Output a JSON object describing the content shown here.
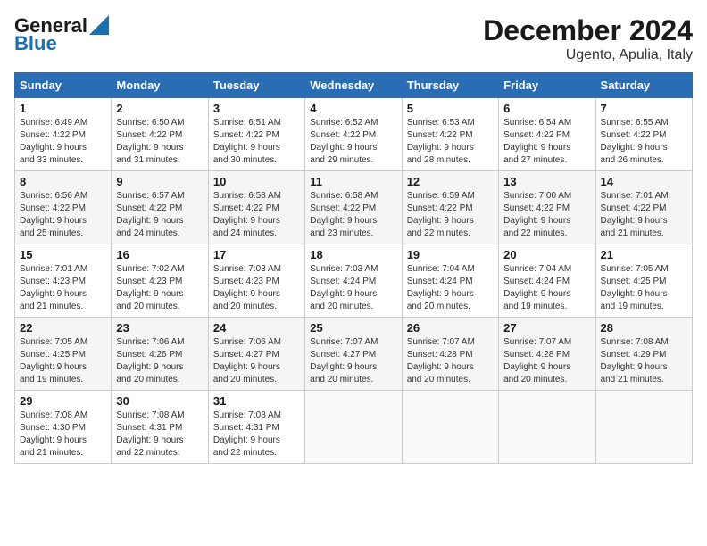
{
  "header": {
    "logo_line1": "General",
    "logo_line2": "Blue",
    "title": "December 2024",
    "subtitle": "Ugento, Apulia, Italy"
  },
  "weekdays": [
    "Sunday",
    "Monday",
    "Tuesday",
    "Wednesday",
    "Thursday",
    "Friday",
    "Saturday"
  ],
  "weeks": [
    [
      {
        "day": "1",
        "info": "Sunrise: 6:49 AM\nSunset: 4:22 PM\nDaylight: 9 hours\nand 33 minutes."
      },
      {
        "day": "2",
        "info": "Sunrise: 6:50 AM\nSunset: 4:22 PM\nDaylight: 9 hours\nand 31 minutes."
      },
      {
        "day": "3",
        "info": "Sunrise: 6:51 AM\nSunset: 4:22 PM\nDaylight: 9 hours\nand 30 minutes."
      },
      {
        "day": "4",
        "info": "Sunrise: 6:52 AM\nSunset: 4:22 PM\nDaylight: 9 hours\nand 29 minutes."
      },
      {
        "day": "5",
        "info": "Sunrise: 6:53 AM\nSunset: 4:22 PM\nDaylight: 9 hours\nand 28 minutes."
      },
      {
        "day": "6",
        "info": "Sunrise: 6:54 AM\nSunset: 4:22 PM\nDaylight: 9 hours\nand 27 minutes."
      },
      {
        "day": "7",
        "info": "Sunrise: 6:55 AM\nSunset: 4:22 PM\nDaylight: 9 hours\nand 26 minutes."
      }
    ],
    [
      {
        "day": "8",
        "info": "Sunrise: 6:56 AM\nSunset: 4:22 PM\nDaylight: 9 hours\nand 25 minutes."
      },
      {
        "day": "9",
        "info": "Sunrise: 6:57 AM\nSunset: 4:22 PM\nDaylight: 9 hours\nand 24 minutes."
      },
      {
        "day": "10",
        "info": "Sunrise: 6:58 AM\nSunset: 4:22 PM\nDaylight: 9 hours\nand 24 minutes."
      },
      {
        "day": "11",
        "info": "Sunrise: 6:58 AM\nSunset: 4:22 PM\nDaylight: 9 hours\nand 23 minutes."
      },
      {
        "day": "12",
        "info": "Sunrise: 6:59 AM\nSunset: 4:22 PM\nDaylight: 9 hours\nand 22 minutes."
      },
      {
        "day": "13",
        "info": "Sunrise: 7:00 AM\nSunset: 4:22 PM\nDaylight: 9 hours\nand 22 minutes."
      },
      {
        "day": "14",
        "info": "Sunrise: 7:01 AM\nSunset: 4:22 PM\nDaylight: 9 hours\nand 21 minutes."
      }
    ],
    [
      {
        "day": "15",
        "info": "Sunrise: 7:01 AM\nSunset: 4:23 PM\nDaylight: 9 hours\nand 21 minutes."
      },
      {
        "day": "16",
        "info": "Sunrise: 7:02 AM\nSunset: 4:23 PM\nDaylight: 9 hours\nand 20 minutes."
      },
      {
        "day": "17",
        "info": "Sunrise: 7:03 AM\nSunset: 4:23 PM\nDaylight: 9 hours\nand 20 minutes."
      },
      {
        "day": "18",
        "info": "Sunrise: 7:03 AM\nSunset: 4:24 PM\nDaylight: 9 hours\nand 20 minutes."
      },
      {
        "day": "19",
        "info": "Sunrise: 7:04 AM\nSunset: 4:24 PM\nDaylight: 9 hours\nand 20 minutes."
      },
      {
        "day": "20",
        "info": "Sunrise: 7:04 AM\nSunset: 4:24 PM\nDaylight: 9 hours\nand 19 minutes."
      },
      {
        "day": "21",
        "info": "Sunrise: 7:05 AM\nSunset: 4:25 PM\nDaylight: 9 hours\nand 19 minutes."
      }
    ],
    [
      {
        "day": "22",
        "info": "Sunrise: 7:05 AM\nSunset: 4:25 PM\nDaylight: 9 hours\nand 19 minutes."
      },
      {
        "day": "23",
        "info": "Sunrise: 7:06 AM\nSunset: 4:26 PM\nDaylight: 9 hours\nand 20 minutes."
      },
      {
        "day": "24",
        "info": "Sunrise: 7:06 AM\nSunset: 4:27 PM\nDaylight: 9 hours\nand 20 minutes."
      },
      {
        "day": "25",
        "info": "Sunrise: 7:07 AM\nSunset: 4:27 PM\nDaylight: 9 hours\nand 20 minutes."
      },
      {
        "day": "26",
        "info": "Sunrise: 7:07 AM\nSunset: 4:28 PM\nDaylight: 9 hours\nand 20 minutes."
      },
      {
        "day": "27",
        "info": "Sunrise: 7:07 AM\nSunset: 4:28 PM\nDaylight: 9 hours\nand 20 minutes."
      },
      {
        "day": "28",
        "info": "Sunrise: 7:08 AM\nSunset: 4:29 PM\nDaylight: 9 hours\nand 21 minutes."
      }
    ],
    [
      {
        "day": "29",
        "info": "Sunrise: 7:08 AM\nSunset: 4:30 PM\nDaylight: 9 hours\nand 21 minutes."
      },
      {
        "day": "30",
        "info": "Sunrise: 7:08 AM\nSunset: 4:31 PM\nDaylight: 9 hours\nand 22 minutes."
      },
      {
        "day": "31",
        "info": "Sunrise: 7:08 AM\nSunset: 4:31 PM\nDaylight: 9 hours\nand 22 minutes."
      },
      {
        "day": "",
        "info": ""
      },
      {
        "day": "",
        "info": ""
      },
      {
        "day": "",
        "info": ""
      },
      {
        "day": "",
        "info": ""
      }
    ]
  ]
}
